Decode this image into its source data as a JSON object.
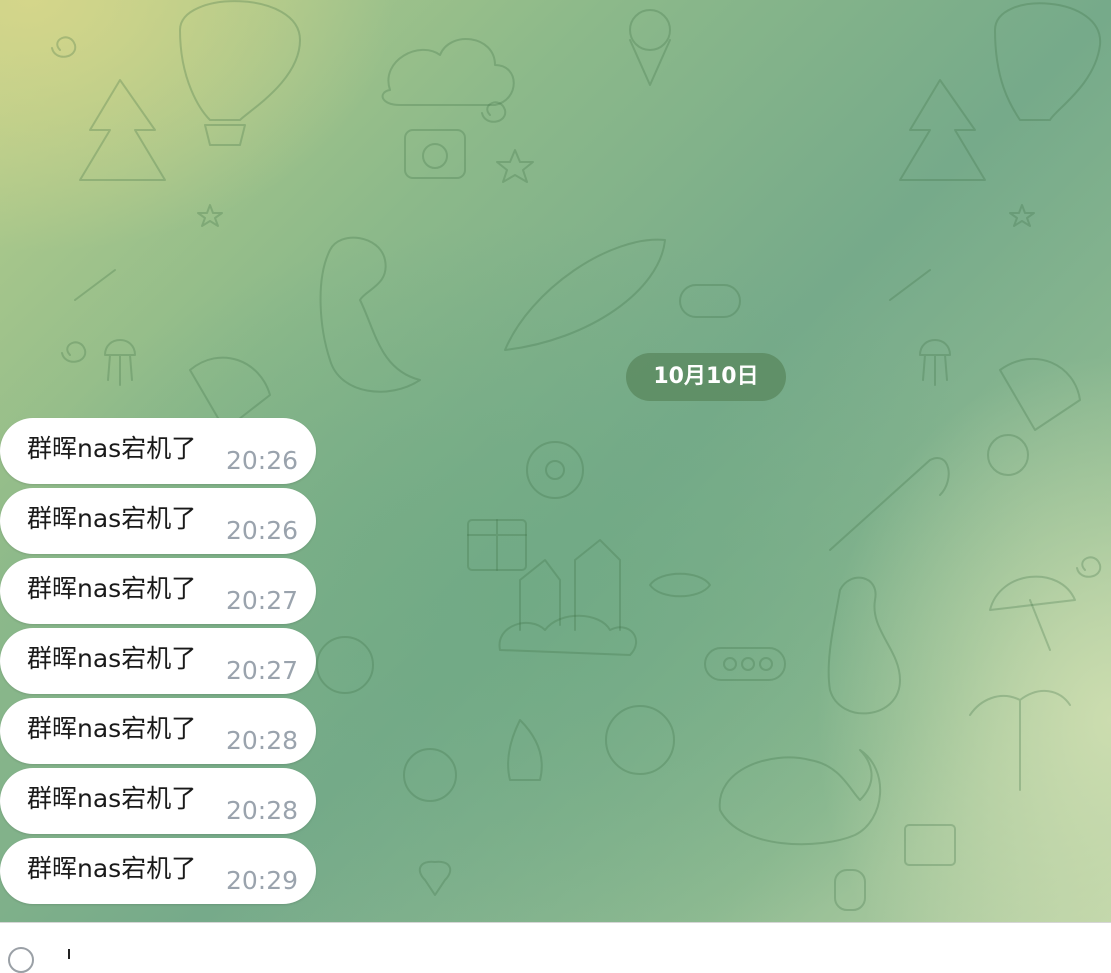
{
  "chat": {
    "date_separator": "10月10日",
    "messages": [
      {
        "text": "群晖nas宕机了",
        "time": "20:26"
      },
      {
        "text": "群晖nas宕机了",
        "time": "20:26"
      },
      {
        "text": "群晖nas宕机了",
        "time": "20:27"
      },
      {
        "text": "群晖nas宕机了",
        "time": "20:27"
      },
      {
        "text": "群晖nas宕机了",
        "time": "20:28"
      },
      {
        "text": "群晖nas宕机了",
        "time": "20:28"
      },
      {
        "text": "群晖nas宕机了",
        "time": "20:29"
      }
    ]
  },
  "composer": {
    "attach_icon": "paperclip-icon"
  },
  "colors": {
    "bubble_bg": "#ffffff",
    "time_text": "#9aa3ad",
    "date_pill_bg": "#5c8a60"
  }
}
